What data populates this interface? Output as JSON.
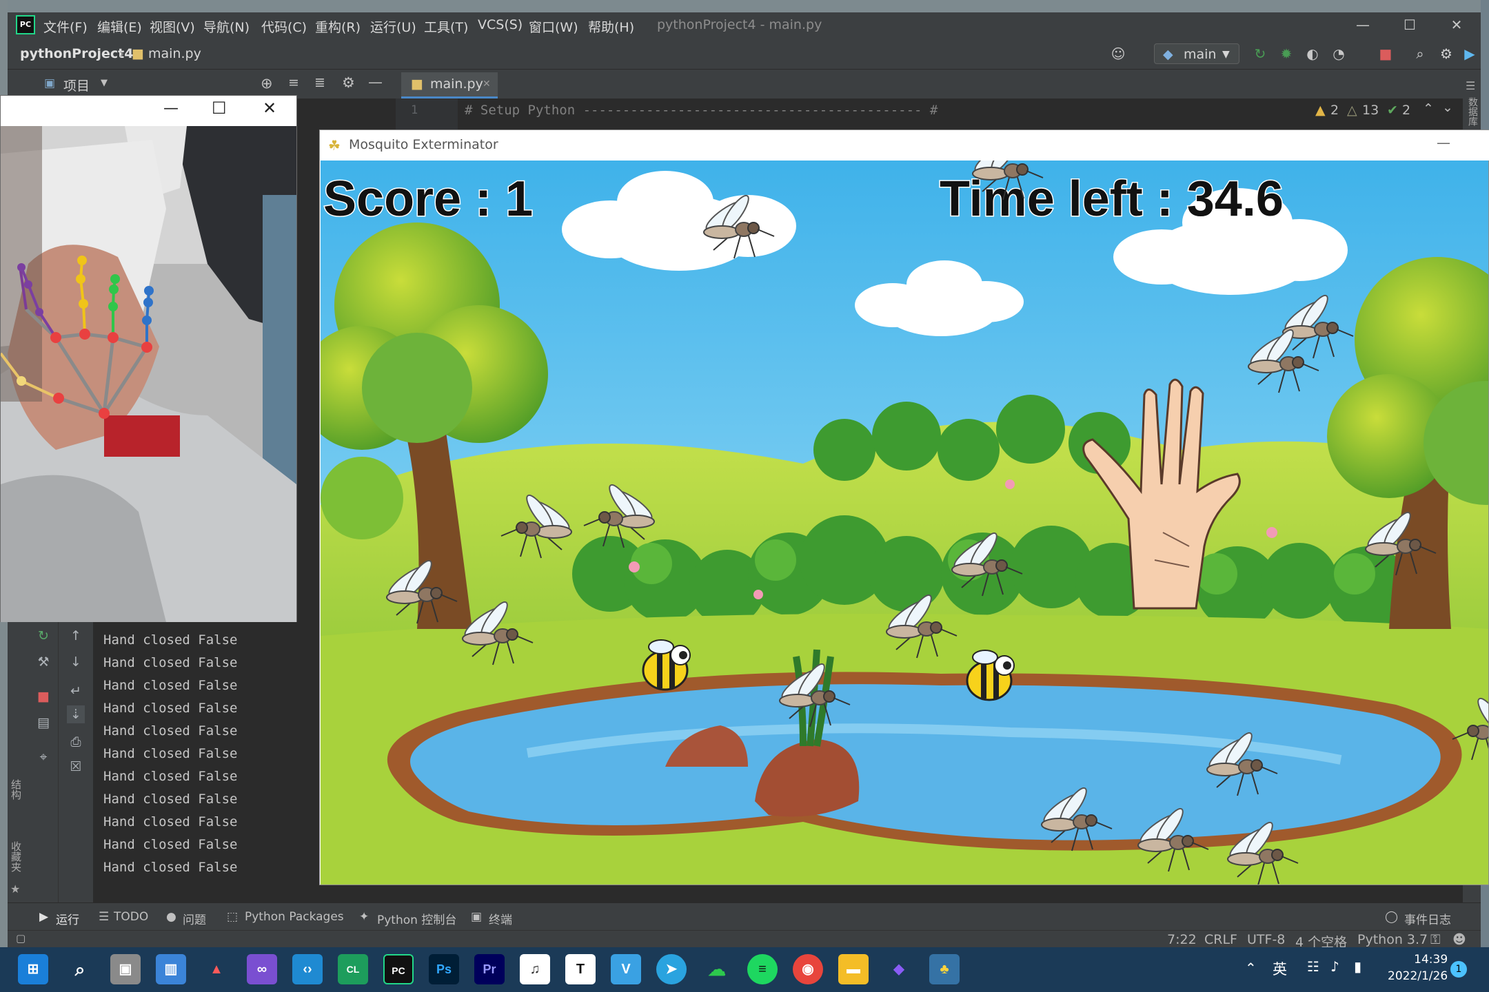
{
  "ide": {
    "menus": [
      "文件(F)",
      "编辑(E)",
      "视图(V)",
      "导航(N)",
      "代码(C)",
      "重构(R)",
      "运行(U)",
      "工具(T)",
      "VCS(S)",
      "窗口(W)",
      "帮助(H)"
    ],
    "window_title": "pythonProject4 - main.py",
    "logo_text": "PC",
    "breadcrumb": {
      "project": "pythonProject4",
      "file": "main.py"
    },
    "branch": "main",
    "project_panel_label": "项目",
    "editor_tab": "main.py",
    "code_line_number": "1",
    "code_line": "# Setup Python ------------------------------------------- #",
    "inspections": {
      "warnings": "2",
      "weak_warnings": "13",
      "ok": "2"
    },
    "left_strip_labels": [
      "结构",
      "收藏夹"
    ],
    "right_strip_label": "数据库"
  },
  "console": {
    "lines": [
      "Hand closed False",
      "Hand closed False",
      "Hand closed False",
      "Hand closed False",
      "Hand closed False",
      "Hand closed False",
      "Hand closed False",
      "Hand closed False",
      "Hand closed False",
      "Hand closed False",
      "Hand closed False"
    ]
  },
  "bottom_tabs": [
    "运行",
    "TODO",
    "问题",
    "Python Packages",
    "Python 控制台",
    "终端"
  ],
  "event_log": "事件日志",
  "status": {
    "position": "7:22",
    "line_sep": "CRLF",
    "encoding": "UTF-8",
    "indent": "4 个空格",
    "interpreter": "Python 3.7"
  },
  "game": {
    "title": "Mosquito Exterminator",
    "score_text": "Score : 1",
    "time_text": "Time left : 34.6"
  },
  "taskbar": {
    "apps": [
      "start",
      "search",
      "task-view",
      "widgets",
      "autodesk",
      "visual-studio",
      "vscode",
      "clion",
      "pycharm",
      "photoshop",
      "premiere",
      "audio",
      "typora",
      "vivaldi",
      "telegram",
      "wechat",
      "spotify",
      "chrome",
      "explorer",
      "obsidian",
      "python"
    ],
    "ime": "英",
    "time": "14:39",
    "date": "2022/1/26",
    "notifications": "1"
  },
  "colors": {
    "ide_bg": "#2b2b2b",
    "ide_panel": "#3c3f41",
    "sky": "#5cc3ef",
    "grass": "#9ccc3c",
    "water": "#5ab4e8"
  }
}
